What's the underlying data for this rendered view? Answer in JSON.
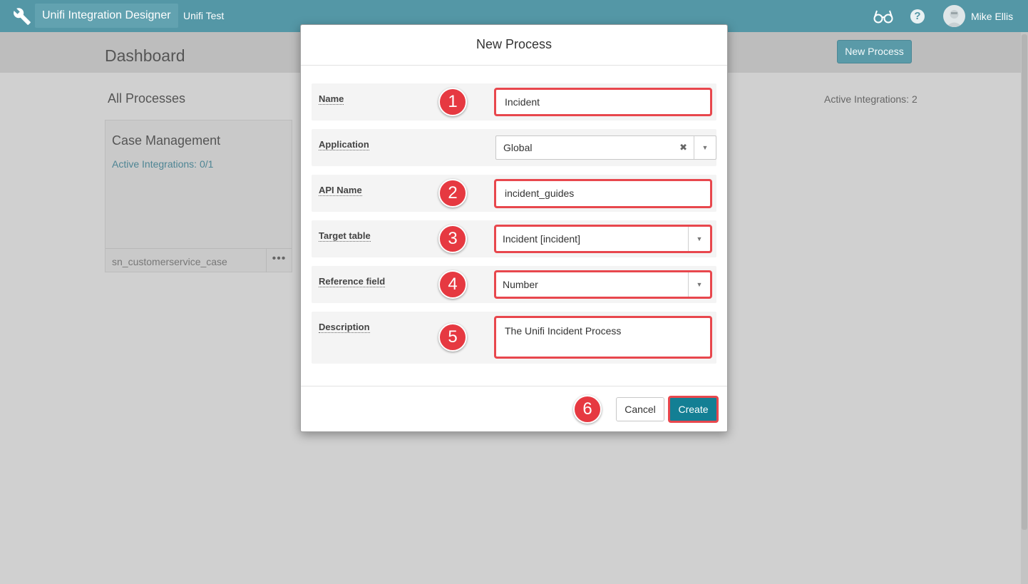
{
  "topbar": {
    "app_title": "Unifi Integration Designer",
    "instance": "Unifi Test",
    "user_name": "Mike Ellis",
    "help_glyph": "?"
  },
  "dashboard": {
    "title": "Dashboard",
    "new_process_label": "New Process",
    "all_processes_label": "All Processes",
    "active_integrations_total": "Active Integrations: 2",
    "cards": [
      {
        "title": "Case Management",
        "active_integrations": "Active Integrations: 0/1",
        "table": "sn_customerservice_case",
        "more_glyph": "•••"
      }
    ]
  },
  "modal": {
    "title": "New Process",
    "fields": {
      "name": {
        "label": "Name",
        "value": "Incident",
        "badge": "1"
      },
      "application": {
        "label": "Application",
        "value": "Global",
        "clear_glyph": "✖"
      },
      "api_name": {
        "label": "API Name",
        "value": "incident_guides",
        "badge": "2"
      },
      "target_table": {
        "label": "Target table",
        "value": "Incident [incident]",
        "badge": "3"
      },
      "reference_field": {
        "label": "Reference field",
        "value": "Number",
        "badge": "4"
      },
      "description": {
        "label": "Description",
        "value": "The Unifi Incident Process",
        "badge": "5"
      }
    },
    "footer": {
      "badge": "6",
      "cancel_label": "Cancel",
      "create_label": "Create"
    }
  },
  "icons": {
    "wrench": "wrench-icon",
    "glasses": "glasses-icon",
    "help": "help-icon",
    "avatar": "avatar-icon",
    "chevron": "chevron-down-icon",
    "clear": "clear-icon"
  },
  "colors": {
    "topbar": "#5497a6",
    "accent": "#137f94",
    "highlight": "#e8474d",
    "badge": "#e63941"
  }
}
